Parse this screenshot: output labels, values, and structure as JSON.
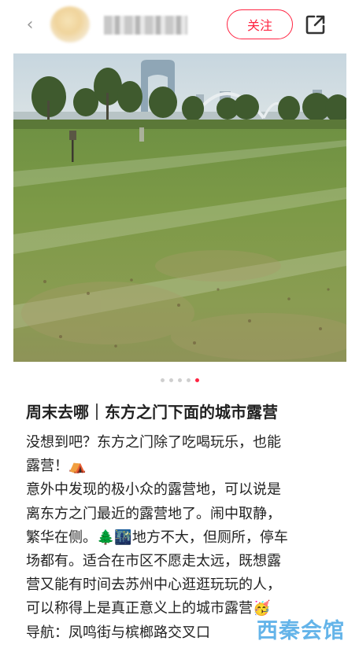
{
  "header": {
    "back_icon": "chevron-left-icon",
    "follow_label": "关注",
    "share_icon": "share-icon",
    "accent_color": "#ff2442"
  },
  "carousel": {
    "total_pages": 5,
    "active_page": 5
  },
  "post": {
    "title": "周末去哪｜东方之门下面的城市露营",
    "lines": [
      "没想到吧？东方之门除了吃喝玩乐，也能",
      "露营！⛺",
      "意外中发现的极小众的露营地，可以说是",
      "离东方之门最近的露营地了。闹中取静，",
      "繁华在侧。🌲🌃地方不大，但厕所，停车",
      "场都有。适合在市区不愿走太远，既想露",
      "营又能有时间去苏州中心逛逛玩玩的人，",
      "可以称得上是真正意义上的城市露营🥳",
      "导航：凤鸣街与槟榔路交叉口"
    ]
  },
  "watermark": "西秦会馆"
}
